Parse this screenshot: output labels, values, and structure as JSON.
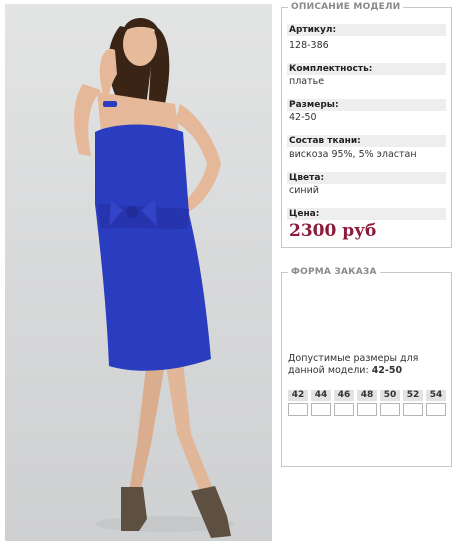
{
  "product_photo": {
    "alt": "",
    "colors": {
      "dress": "#2a3cbf",
      "skin": "#e4b898",
      "hair": "#3a2416",
      "shoes": "#5d5040"
    }
  },
  "description": {
    "legend": "ОПИСАНИЕ МОДЕЛИ",
    "fields": [
      {
        "label": "Артикул:",
        "value": "128-386"
      },
      {
        "label": "Комплектность:",
        "value": "платье"
      },
      {
        "label": "Размеры:",
        "value": "42-50"
      },
      {
        "label": "Состав ткани:",
        "value": "вискоза 95%, 5% эластан"
      },
      {
        "label": "Цвета:",
        "value": "синий"
      },
      {
        "label": "Цена:",
        "value": "2300 руб"
      }
    ],
    "price_color": "#8c1a3a"
  },
  "order": {
    "legend": "ФОРМА ЗАКАЗА",
    "allowed_prefix": "Допустимые размеры для данной модели: ",
    "allowed_range": "42-50",
    "sizes": [
      "42",
      "44",
      "46",
      "48",
      "50",
      "52",
      "54"
    ]
  }
}
